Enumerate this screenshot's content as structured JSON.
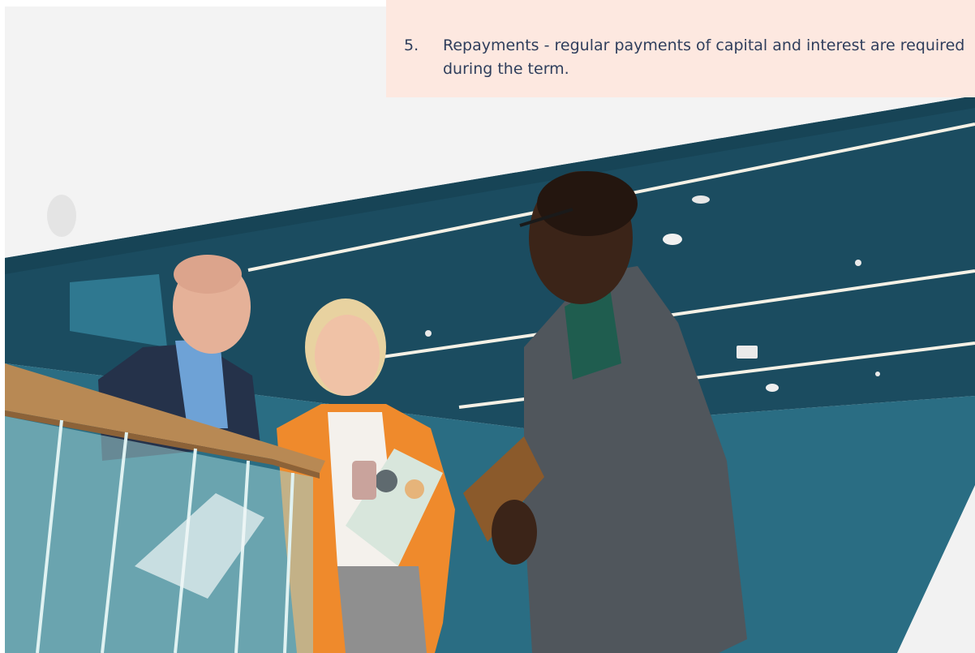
{
  "callout": {
    "item_number": "5.",
    "item_text": "Repayments - regular payments of capital and interest are required\nduring the term."
  },
  "photo": {
    "icon": "office-meeting-photo",
    "colors": {
      "ceiling": "#1a4a5e",
      "wall": "#2a6a80",
      "orange_blazer": "#f08a2c",
      "handrail": "#b88954"
    }
  }
}
